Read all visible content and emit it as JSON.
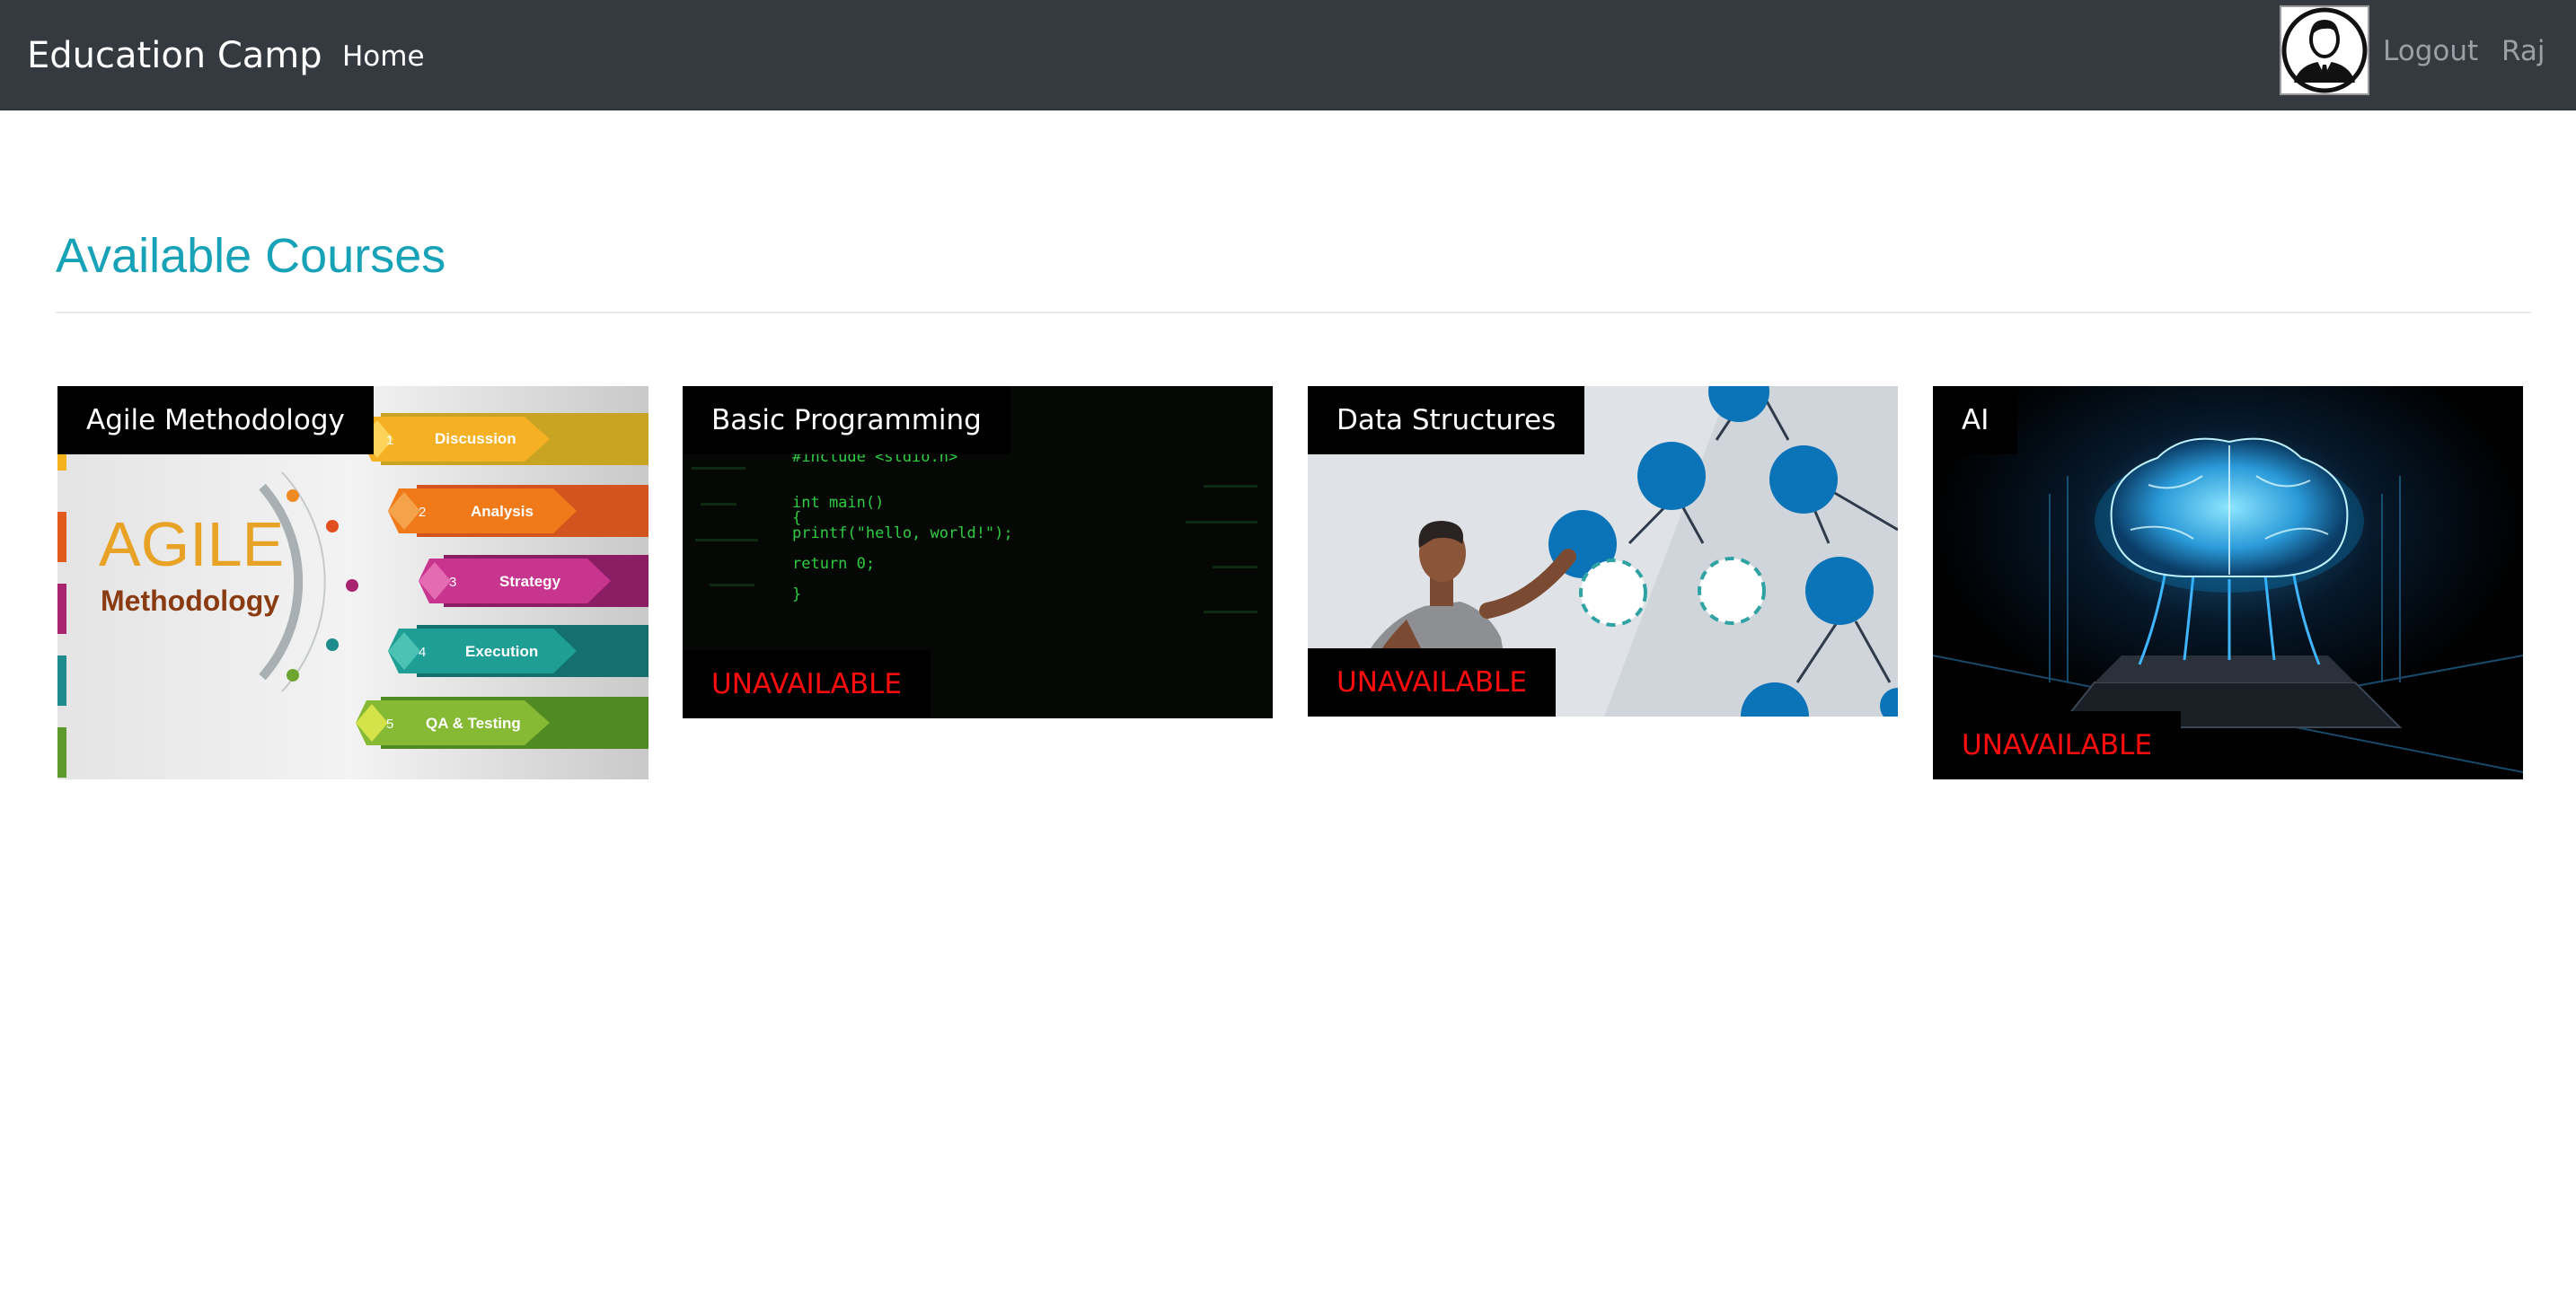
{
  "navbar": {
    "brand": "Education Camp",
    "home": "Home",
    "logout": "Logout",
    "user": "Raj"
  },
  "page": {
    "title": "Available Courses"
  },
  "courses": [
    {
      "title": "Agile Methodology",
      "status": "",
      "art": {
        "headline": "AGILE",
        "subline": "Methodology",
        "steps": [
          {
            "n": "1",
            "label": "Discussion"
          },
          {
            "n": "2",
            "label": "Analysis"
          },
          {
            "n": "3",
            "label": "Strategy"
          },
          {
            "n": "4",
            "label": "Execution"
          },
          {
            "n": "5",
            "label": "QA & Testing"
          }
        ]
      }
    },
    {
      "title": "Basic Programming",
      "status": "UNAVAILABLE",
      "art": {
        "code": [
          "#include <stdio.h>",
          "",
          "int main()",
          "{",
          "   printf(\"hello, world!\");",
          "   return 0;",
          "}"
        ]
      }
    },
    {
      "title": "Data Structures",
      "status": "UNAVAILABLE"
    },
    {
      "title": "AI",
      "status": "UNAVAILABLE"
    }
  ],
  "colors": {
    "navbar_bg": "#343a40",
    "title_accent": "#17a2b8",
    "unavailable": "#ff0d0d"
  }
}
